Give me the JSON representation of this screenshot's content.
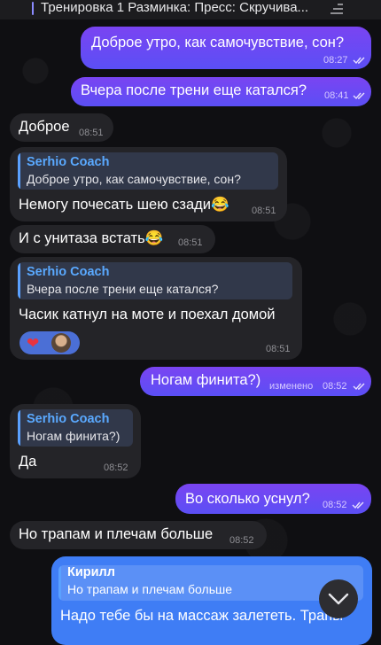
{
  "pinned": {
    "text": "Тренировка 1 Разминка: Пресс: Скручива..."
  },
  "messages": [
    {
      "text": "Доброе утро, как самочувствие, сон?",
      "time": "08:27"
    },
    {
      "text": "Вчера после трени еще катался?",
      "time": "08:41"
    },
    {
      "text": "Доброе",
      "time": "08:51"
    },
    {
      "reply_name": "Serhio Coach",
      "reply_text": "Доброе утро, как самочувствие, сон?",
      "text": "Немогу почесать шею сзади😂",
      "time": "08:51"
    },
    {
      "text": "И с унитаза встать😂",
      "time": "08:51"
    },
    {
      "reply_name": "Serhio Coach",
      "reply_text": "Вчера после трени еще катался?",
      "text": "Часик катнул на моте и поехал домой",
      "time": "08:51"
    },
    {
      "text": "Ногам финита?)",
      "edited": "изменено",
      "time": "08:52"
    },
    {
      "reply_name": "Serhio Coach",
      "reply_text": "Ногам финита?)",
      "text": "Да",
      "time": "08:52"
    },
    {
      "text": "Во сколько уснул?",
      "time": "08:52"
    },
    {
      "text": "Но трапам и плечам больше",
      "time": "08:52"
    },
    {
      "reply_name": "Кирилл",
      "reply_text": "Но трапам и плечам больше",
      "text": "Надо тебе бы на массаж залететь. Трапы"
    }
  ],
  "reaction": {
    "emoji": "❤"
  },
  "icons": {
    "pinned": "pin-list-icon",
    "read": "double-check-icon",
    "scroll": "chevron-down-icon",
    "heart": "heart-icon",
    "avatar": "avatar"
  }
}
